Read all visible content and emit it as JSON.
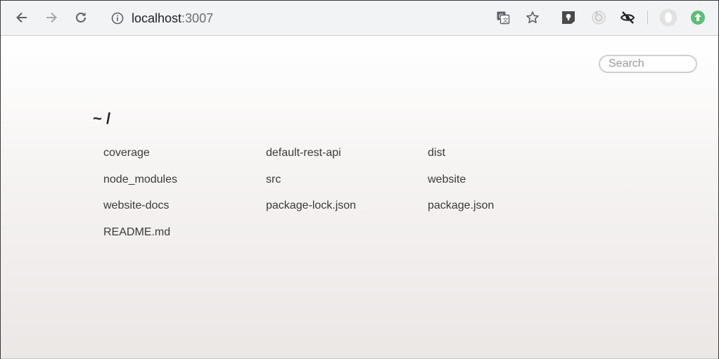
{
  "browser": {
    "url_host": "localhost",
    "url_port": ":3007",
    "icons": {
      "back": "arrow-left-icon",
      "forward": "arrow-right-icon",
      "reload": "reload-icon",
      "info": "info-icon",
      "translate": "translate-icon",
      "bookmark": "star-icon",
      "ext1": "keep-icon",
      "ext2": "lens-icon",
      "ext3": "hidden-eye-icon",
      "profile": "avatar-icon",
      "update": "update-arrow-icon"
    },
    "update_color": "#5bbf75"
  },
  "page": {
    "search_placeholder": "Search",
    "path": "~ /",
    "files": [
      "coverage",
      "default-rest-api",
      "dist",
      "node_modules",
      "src",
      "website",
      "website-docs",
      "package-lock.json",
      "package.json",
      "README.md"
    ]
  }
}
